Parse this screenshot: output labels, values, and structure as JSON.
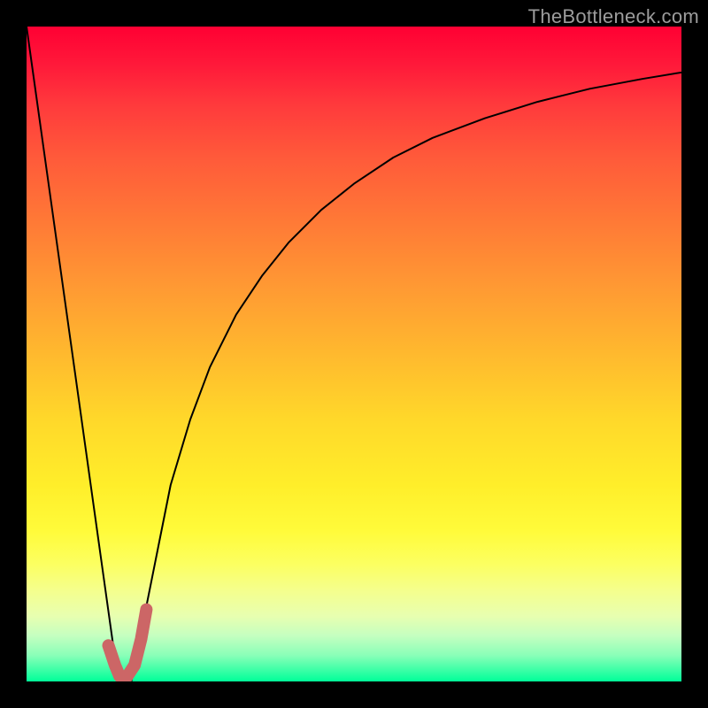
{
  "watermark": "TheBottleneck.com",
  "chart_data": {
    "type": "line",
    "title": "",
    "xlabel": "",
    "ylabel": "",
    "xlim": [
      0,
      100
    ],
    "ylim": [
      0,
      100
    ],
    "grid": false,
    "legend": false,
    "series": [
      {
        "name": "left-slope",
        "x": [
          0,
          14
        ],
        "y": [
          100,
          0
        ],
        "stroke": "#000000",
        "width": 2
      },
      {
        "name": "right-curve",
        "x": [
          16,
          18,
          20,
          22,
          25,
          28,
          32,
          36,
          40,
          45,
          50,
          56,
          62,
          70,
          78,
          86,
          94,
          100
        ],
        "y": [
          0,
          10,
          20,
          30,
          40,
          48,
          56,
          62,
          67,
          72,
          76,
          80,
          83,
          86,
          88.5,
          90.5,
          92,
          93
        ],
        "stroke": "#000000",
        "width": 2
      },
      {
        "name": "highlight-hook",
        "x": [
          12.5,
          13.5,
          14.2,
          15.2,
          16.5,
          17.5,
          18.3
        ],
        "y": [
          5.5,
          2.5,
          0.8,
          0.5,
          2.5,
          6.5,
          11
        ],
        "stroke": "#cc6666",
        "width": 14,
        "linecap": "round"
      }
    ],
    "background_gradient": {
      "direction": "top-to-bottom",
      "stops": [
        {
          "pos": 0,
          "color": "#ff0033"
        },
        {
          "pos": 50,
          "color": "#ffd224"
        },
        {
          "pos": 82,
          "color": "#fbff55"
        },
        {
          "pos": 100,
          "color": "#00ff99"
        }
      ]
    }
  }
}
